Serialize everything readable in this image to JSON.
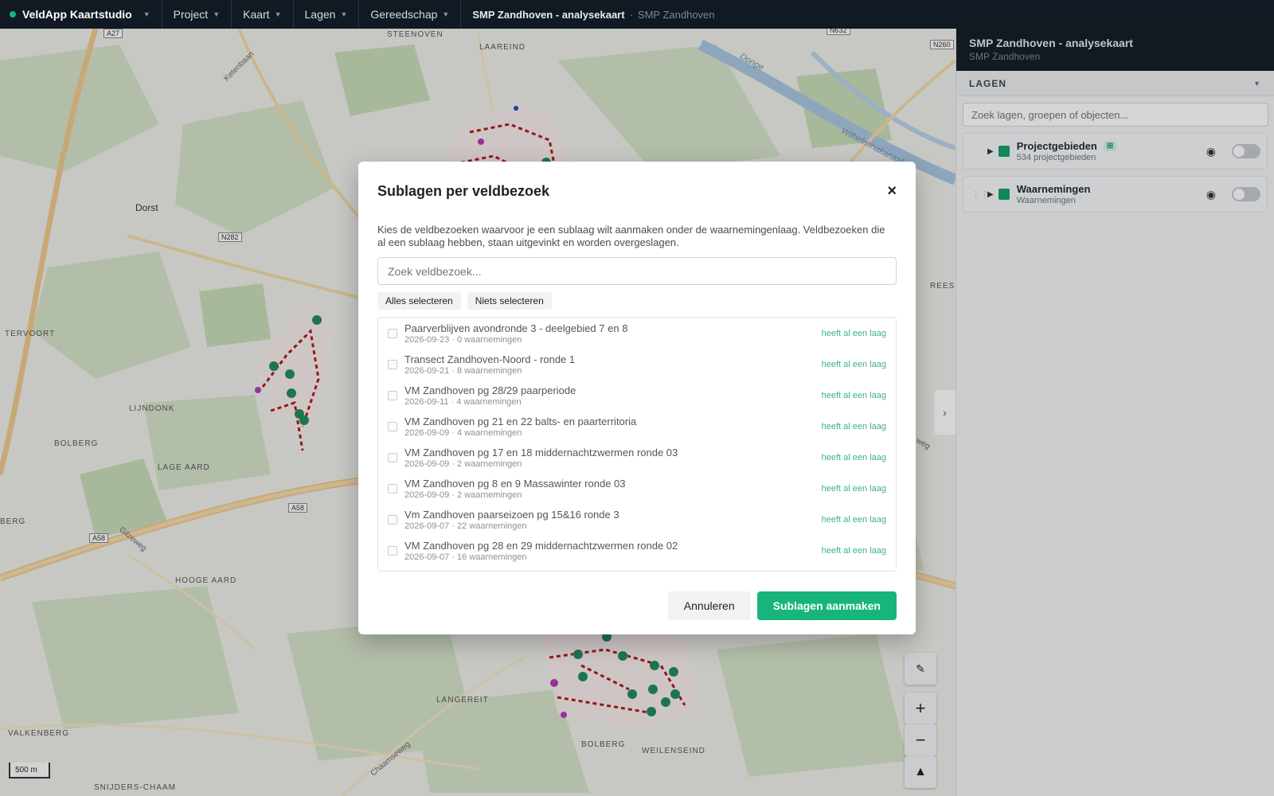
{
  "topbar": {
    "brand": "VeldApp Kaartstudio",
    "menu": [
      "Project",
      "Kaart",
      "Lagen",
      "Gereedschap"
    ],
    "breadcrumb_main": "SMP Zandhoven - analysekaart",
    "breadcrumb_sep": "·",
    "breadcrumb_sub": "SMP Zandhoven"
  },
  "map": {
    "labels": [
      "Dorst",
      "TERVOORT",
      "LIJNDONK",
      "BOLBERG",
      "LAGE AARD",
      "HOOGE AARD",
      "VALKENBERG",
      "SNIJDERS-CHAAM",
      "LANGEREIT",
      "BOLBERG",
      "WEILENSEIND",
      "STEENOVEN",
      "LAAREIND",
      "REESH",
      "BERG",
      "Ketenbaan",
      "Donge",
      "Wilhelminakanaal",
      "Gilzeweg",
      "Chaamseweg",
      "weg"
    ],
    "road_tags": [
      "A27",
      "N282",
      "A58",
      "A58",
      "N260",
      "N632"
    ],
    "scale": "500 m"
  },
  "controls": {
    "zoom_in": "+",
    "zoom_out": "−",
    "compass": "▲",
    "pin": "✎",
    "collapse": "›"
  },
  "sidebar": {
    "title": "SMP Zandhoven - analysekaart",
    "subtitle": "SMP Zandhoven",
    "section": "LAGEN",
    "section_caret": "▼",
    "search_placeholder": "Zoek lagen, groepen of objecten...",
    "layers": [
      {
        "name": "Projectgebieden",
        "sub": "534 projectgebieden",
        "badge": "⊞",
        "color": "#12a064",
        "visible": false
      },
      {
        "name": "Waarnemingen",
        "sub": "Waarnemingen",
        "color": "#12a064",
        "visible": false
      }
    ]
  },
  "modal": {
    "title": "Sublagen per veldbezoek",
    "close": "×",
    "description": "Kies de veldbezoeken waarvoor je een sublaag wilt aanmaken onder de waarnemingenlaag. Veldbezoeken die al een sublaag hebben, staan uitgevinkt en worden overgeslagen.",
    "search_placeholder": "Zoek veldbezoek...",
    "select_all": "Alles selecteren",
    "select_none": "Niets selecteren",
    "items": [
      {
        "title": "Paarverblijven avondronde 3 - deelgebied 7 en 8",
        "meta": "2026-09-23 · 0 waarnemingen",
        "note": "heeft al een laag",
        "checked": false
      },
      {
        "title": "Transect Zandhoven-Noord - ronde 1",
        "meta": "2026-09-21 · 8 waarnemingen",
        "note": "heeft al een laag",
        "checked": false
      },
      {
        "title": "VM Zandhoven pg 28/29 paarperiode",
        "meta": "2026-09-11 · 4 waarnemingen",
        "note": "heeft al een laag",
        "checked": false
      },
      {
        "title": "VM Zandhoven pg 21 en 22 balts- en paarterritoria",
        "meta": "2026-09-09 · 4 waarnemingen",
        "note": "heeft al een laag",
        "checked": false
      },
      {
        "title": "VM Zandhoven pg 17 en 18 middernachtzwermen ronde 03",
        "meta": "2026-09-09 · 2 waarnemingen",
        "note": "heeft al een laag",
        "checked": false
      },
      {
        "title": "VM Zandhoven pg 8 en 9 Massawinter ronde 03",
        "meta": "2026-09-09 · 2 waarnemingen",
        "note": "heeft al een laag",
        "checked": false
      },
      {
        "title": "Vm Zandhoven paarseizoen pg 15&16 ronde 3",
        "meta": "2026-09-07 · 22 waarnemingen",
        "note": "heeft al een laag",
        "checked": false
      },
      {
        "title": "VM Zandhoven pg 28 en 29 middernachtzwermen ronde 02",
        "meta": "2026-09-07 · 16 waarnemingen",
        "note": "heeft al een laag",
        "checked": false
      }
    ],
    "cancel": "Annuleren",
    "confirm": "Sublagen aanmaken"
  },
  "colors": {
    "accent": "#17b57b",
    "topbar": "#111a23",
    "marker": "#1a8a5a",
    "survey_line": "#b01818"
  }
}
